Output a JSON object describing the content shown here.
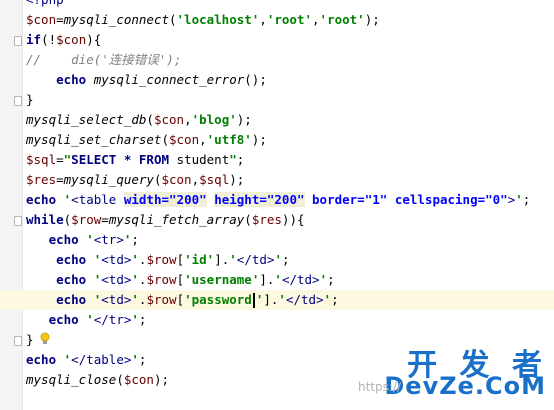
{
  "lines": [
    {
      "tokens": [
        {
          "t": "tag",
          "v": "<?php"
        }
      ]
    },
    {
      "tokens": [
        {
          "t": "var",
          "v": "$con"
        },
        {
          "t": "plain",
          "v": "="
        },
        {
          "t": "fn",
          "v": "mysqli_connect"
        },
        {
          "t": "plain",
          "v": "("
        },
        {
          "t": "str",
          "v": "'localhost'"
        },
        {
          "t": "plain",
          "v": ","
        },
        {
          "t": "str",
          "v": "'root'"
        },
        {
          "t": "plain",
          "v": ","
        },
        {
          "t": "str",
          "v": "'root'"
        },
        {
          "t": "plain",
          "v": ");"
        }
      ]
    },
    {
      "fold": true,
      "tokens": [
        {
          "t": "kw",
          "v": "if"
        },
        {
          "t": "plain",
          "v": "(!"
        },
        {
          "t": "var",
          "v": "$con"
        },
        {
          "t": "plain",
          "v": "){"
        }
      ]
    },
    {
      "tokens": [
        {
          "t": "cm",
          "v": "//    die('连接错误');"
        }
      ]
    },
    {
      "tokens": [
        {
          "t": "plain",
          "v": "    "
        },
        {
          "t": "kw",
          "v": "echo"
        },
        {
          "t": "plain",
          "v": " "
        },
        {
          "t": "fn",
          "v": "mysqli_connect_error"
        },
        {
          "t": "plain",
          "v": "();"
        }
      ]
    },
    {
      "fold": true,
      "tokens": [
        {
          "t": "plain",
          "v": "}"
        }
      ]
    },
    {
      "tokens": [
        {
          "t": "fn",
          "v": "mysqli_select_db"
        },
        {
          "t": "plain",
          "v": "("
        },
        {
          "t": "var",
          "v": "$con"
        },
        {
          "t": "plain",
          "v": ","
        },
        {
          "t": "str",
          "v": "'blog'"
        },
        {
          "t": "plain",
          "v": ");"
        }
      ]
    },
    {
      "tokens": [
        {
          "t": "fn",
          "v": "mysqli_set_charset"
        },
        {
          "t": "plain",
          "v": "("
        },
        {
          "t": "var",
          "v": "$con"
        },
        {
          "t": "plain",
          "v": ","
        },
        {
          "t": "str",
          "v": "'utf8'"
        },
        {
          "t": "plain",
          "v": ");"
        }
      ]
    },
    {
      "tokens": [
        {
          "t": "var",
          "v": "$sql"
        },
        {
          "t": "plain",
          "v": "="
        },
        {
          "t": "str",
          "v": "\""
        },
        {
          "t": "sql",
          "v": "SELECT * FROM"
        },
        {
          "t": "sqlt",
          "v": " student"
        },
        {
          "t": "str",
          "v": "\""
        },
        {
          "t": "plain",
          "v": ";"
        }
      ]
    },
    {
      "tokens": [
        {
          "t": "var",
          "v": "$res"
        },
        {
          "t": "plain",
          "v": "="
        },
        {
          "t": "fn",
          "v": "mysqli_query"
        },
        {
          "t": "plain",
          "v": "("
        },
        {
          "t": "var",
          "v": "$con"
        },
        {
          "t": "plain",
          "v": ","
        },
        {
          "t": "var",
          "v": "$sql"
        },
        {
          "t": "plain",
          "v": ");"
        }
      ]
    },
    {
      "tokens": [
        {
          "t": "kw",
          "v": "echo"
        },
        {
          "t": "plain",
          "v": " "
        },
        {
          "t": "str",
          "v": "'"
        },
        {
          "t": "tag",
          "v": "<table "
        },
        {
          "t": "attrbg",
          "v": "width=\"200\""
        },
        {
          "t": "plain",
          "v": " "
        },
        {
          "t": "attrbg",
          "v": "height=\"200\""
        },
        {
          "t": "plain",
          "v": " "
        },
        {
          "t": "attr",
          "v": "border=\"1\""
        },
        {
          "t": "plain",
          "v": " "
        },
        {
          "t": "attr",
          "v": "cellspacing=\"0\""
        },
        {
          "t": "tag",
          "v": ">"
        },
        {
          "t": "str",
          "v": "'"
        },
        {
          "t": "plain",
          "v": ";"
        }
      ]
    },
    {
      "fold": true,
      "tokens": [
        {
          "t": "kw",
          "v": "while"
        },
        {
          "t": "plain",
          "v": "("
        },
        {
          "t": "var",
          "v": "$row"
        },
        {
          "t": "plain",
          "v": "="
        },
        {
          "t": "fn",
          "v": "mysqli_fetch_array"
        },
        {
          "t": "plain",
          "v": "("
        },
        {
          "t": "var",
          "v": "$res"
        },
        {
          "t": "plain",
          "v": ")){"
        }
      ]
    },
    {
      "tokens": [
        {
          "t": "plain",
          "v": "   "
        },
        {
          "t": "kw",
          "v": "echo"
        },
        {
          "t": "plain",
          "v": " "
        },
        {
          "t": "str",
          "v": "'"
        },
        {
          "t": "tag",
          "v": "<tr>"
        },
        {
          "t": "str",
          "v": "'"
        },
        {
          "t": "plain",
          "v": ";"
        }
      ]
    },
    {
      "tokens": [
        {
          "t": "plain",
          "v": "    "
        },
        {
          "t": "kw",
          "v": "echo"
        },
        {
          "t": "plain",
          "v": " "
        },
        {
          "t": "str",
          "v": "'"
        },
        {
          "t": "tag",
          "v": "<td>"
        },
        {
          "t": "str",
          "v": "'"
        },
        {
          "t": "plain",
          "v": "."
        },
        {
          "t": "var",
          "v": "$row"
        },
        {
          "t": "plain",
          "v": "["
        },
        {
          "t": "str",
          "v": "'id'"
        },
        {
          "t": "plain",
          "v": "]."
        },
        {
          "t": "str",
          "v": "'"
        },
        {
          "t": "tag",
          "v": "</td>"
        },
        {
          "t": "str",
          "v": "'"
        },
        {
          "t": "plain",
          "v": ";"
        }
      ]
    },
    {
      "tokens": [
        {
          "t": "plain",
          "v": "    "
        },
        {
          "t": "kw",
          "v": "echo"
        },
        {
          "t": "plain",
          "v": " "
        },
        {
          "t": "str",
          "v": "'"
        },
        {
          "t": "tag",
          "v": "<td>"
        },
        {
          "t": "str",
          "v": "'"
        },
        {
          "t": "plain",
          "v": "."
        },
        {
          "t": "var",
          "v": "$row"
        },
        {
          "t": "plain",
          "v": "["
        },
        {
          "t": "str",
          "v": "'username'"
        },
        {
          "t": "plain",
          "v": "]."
        },
        {
          "t": "str",
          "v": "'"
        },
        {
          "t": "tag",
          "v": "</td>"
        },
        {
          "t": "str",
          "v": "'"
        },
        {
          "t": "plain",
          "v": ";"
        }
      ]
    },
    {
      "hl": true,
      "tokens": [
        {
          "t": "plain",
          "v": "    "
        },
        {
          "t": "kw",
          "v": "echo"
        },
        {
          "t": "plain",
          "v": " "
        },
        {
          "t": "str",
          "v": "'"
        },
        {
          "t": "tag",
          "v": "<td>"
        },
        {
          "t": "str",
          "v": "'"
        },
        {
          "t": "plain",
          "v": "."
        },
        {
          "t": "var",
          "v": "$row"
        },
        {
          "t": "plain",
          "v": "["
        },
        {
          "t": "str",
          "v": "'password"
        },
        {
          "t": "caret",
          "v": ""
        },
        {
          "t": "str",
          "v": "'"
        },
        {
          "t": "plain",
          "v": "]."
        },
        {
          "t": "str",
          "v": "'"
        },
        {
          "t": "tag",
          "v": "</td>"
        },
        {
          "t": "str",
          "v": "'"
        },
        {
          "t": "plain",
          "v": ";"
        }
      ]
    },
    {
      "tokens": [
        {
          "t": "plain",
          "v": "   "
        },
        {
          "t": "kw",
          "v": "echo"
        },
        {
          "t": "plain",
          "v": " "
        },
        {
          "t": "str",
          "v": "'"
        },
        {
          "t": "tag",
          "v": "</tr>"
        },
        {
          "t": "str",
          "v": "'"
        },
        {
          "t": "plain",
          "v": ";"
        }
      ]
    },
    {
      "fold": true,
      "tokens": [
        {
          "t": "plain",
          "v": "}"
        }
      ]
    },
    {
      "tokens": [
        {
          "t": "kw",
          "v": "echo"
        },
        {
          "t": "plain",
          "v": " "
        },
        {
          "t": "str",
          "v": "'"
        },
        {
          "t": "tag",
          "v": "</table>"
        },
        {
          "t": "str",
          "v": "'"
        },
        {
          "t": "plain",
          "v": ";"
        }
      ]
    },
    {
      "tokens": [
        {
          "t": "fn",
          "v": "mysqli_close"
        },
        {
          "t": "plain",
          "v": "("
        },
        {
          "t": "var",
          "v": "$con"
        },
        {
          "t": "plain",
          "v": ");"
        }
      ]
    }
  ],
  "watermark": {
    "cn": "开 发 者",
    "en": "DevZe.CoM",
    "url": "https://"
  },
  "icons": {
    "bulb": "lightbulb-icon"
  }
}
